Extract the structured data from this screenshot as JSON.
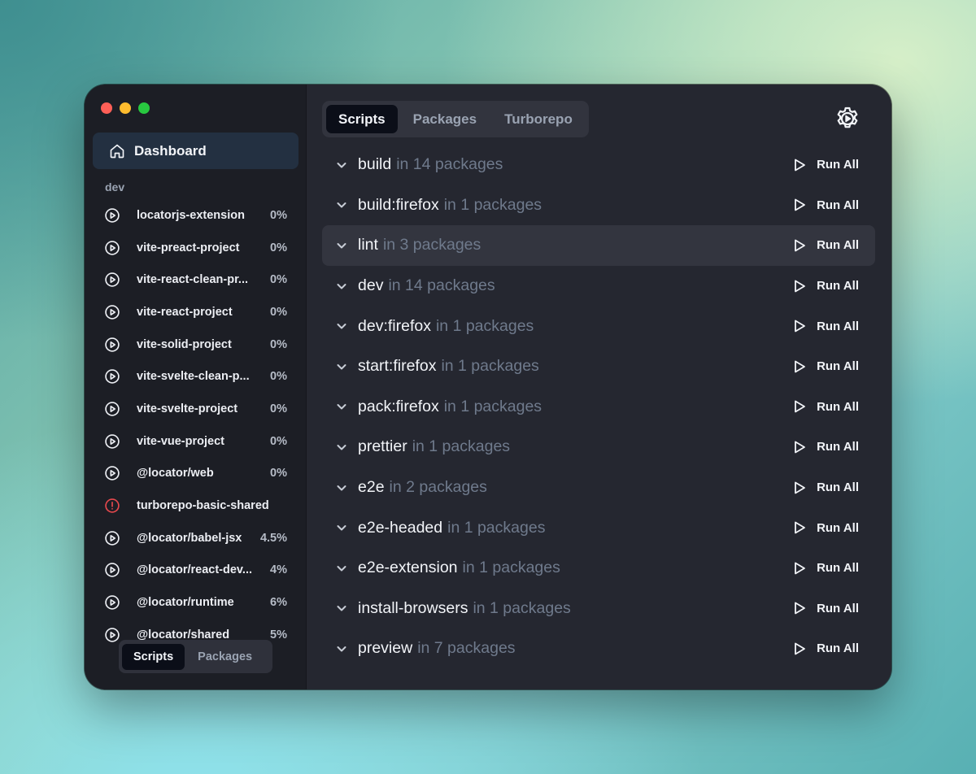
{
  "sidebar": {
    "dashboard_label": "Dashboard",
    "group_label": "dev",
    "packages": [
      {
        "name": "locatorjs-extension",
        "percent": "0%",
        "status": "play"
      },
      {
        "name": "vite-preact-project",
        "percent": "0%",
        "status": "play"
      },
      {
        "name": "vite-react-clean-pr...",
        "percent": "0%",
        "status": "play"
      },
      {
        "name": "vite-react-project",
        "percent": "0%",
        "status": "play"
      },
      {
        "name": "vite-solid-project",
        "percent": "0%",
        "status": "play"
      },
      {
        "name": "vite-svelte-clean-p...",
        "percent": "0%",
        "status": "play"
      },
      {
        "name": "vite-svelte-project",
        "percent": "0%",
        "status": "play"
      },
      {
        "name": "vite-vue-project",
        "percent": "0%",
        "status": "play"
      },
      {
        "name": "@locator/web",
        "percent": "0%",
        "status": "play"
      },
      {
        "name": "turborepo-basic-shared",
        "percent": "",
        "status": "error"
      },
      {
        "name": "@locator/babel-jsx",
        "percent": "4.5%",
        "status": "play"
      },
      {
        "name": "@locator/react-dev...",
        "percent": "4%",
        "status": "play"
      },
      {
        "name": "@locator/runtime",
        "percent": "6%",
        "status": "play"
      },
      {
        "name": "@locator/shared",
        "percent": "5%",
        "status": "play"
      }
    ],
    "tabs": [
      "Scripts",
      "Packages"
    ],
    "active_tab": "Scripts"
  },
  "main": {
    "tabs": [
      "Scripts",
      "Packages",
      "Turborepo"
    ],
    "active_tab": "Scripts",
    "run_all_label": "Run All",
    "scripts": [
      {
        "name": "build",
        "count": "in 14 packages"
      },
      {
        "name": "build:firefox",
        "count": "in 1 packages"
      },
      {
        "name": "lint",
        "count": "in 3 packages",
        "hover": true
      },
      {
        "name": "dev",
        "count": "in 14 packages"
      },
      {
        "name": "dev:firefox",
        "count": "in 1 packages"
      },
      {
        "name": "start:firefox",
        "count": "in 1 packages"
      },
      {
        "name": "pack:firefox",
        "count": "in 1 packages"
      },
      {
        "name": "prettier",
        "count": "in 1 packages"
      },
      {
        "name": "e2e",
        "count": "in 2 packages"
      },
      {
        "name": "e2e-headed",
        "count": "in 1 packages"
      },
      {
        "name": "e2e-extension",
        "count": "in 1 packages"
      },
      {
        "name": "install-browsers",
        "count": "in 1 packages"
      },
      {
        "name": "preview",
        "count": "in 7 packages"
      }
    ]
  },
  "icons": {
    "home": "home-icon",
    "play_circle": "play-circle-icon",
    "error_circle": "alert-circle-icon",
    "chevron": "chevron-down-icon",
    "play": "play-icon",
    "settings": "gear-icon"
  },
  "colors": {
    "accent_active_tab": "#0b0e18",
    "dashboard_highlight": "#233041",
    "error": "#e5484d",
    "muted_text": "#6f7a8c"
  }
}
